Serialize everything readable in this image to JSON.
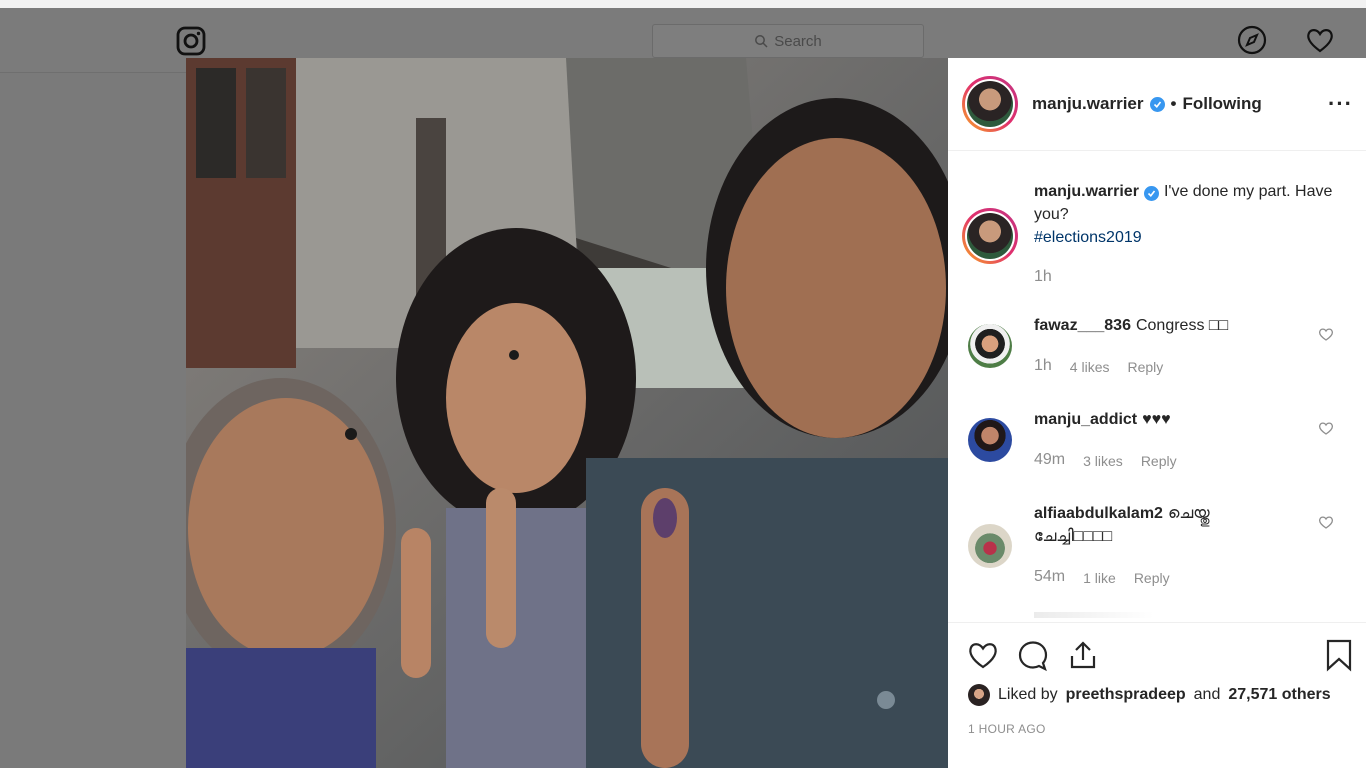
{
  "nav": {
    "search_placeholder": "Search",
    "logo_icon": "instagram-icon",
    "explore_icon": "compass-icon",
    "activity_icon": "heart-icon"
  },
  "post": {
    "author": "manju.warrier",
    "follow_state": "Following",
    "more_icon": "more-icon",
    "more_label": "···"
  },
  "caption": {
    "username": "manju.warrier",
    "text": "I've done my part. Have you?",
    "hashtag": "#elections2019",
    "time": "1h"
  },
  "comments": [
    {
      "username": "fawaz___836",
      "text": "Congress □□",
      "time": "1h",
      "likes": "4 likes",
      "reply": "Reply"
    },
    {
      "username": "manju_addict",
      "text": "♥♥♥",
      "time": "49m",
      "likes": "3 likes",
      "reply": "Reply"
    },
    {
      "username": "alfiaabdulkalam2",
      "text": "ചെയ്തു ചേച്ചി□□□□",
      "time": "54m",
      "likes": "1 like",
      "reply": "Reply"
    }
  ],
  "actions": {
    "like_icon": "heart-icon",
    "comment_icon": "comment-icon",
    "share_icon": "share-icon",
    "save_icon": "bookmark-icon"
  },
  "likes": {
    "prefix": "Liked by",
    "user": "preethspradeep",
    "joiner": "and",
    "others": "27,571 others"
  },
  "timestamp": "1 HOUR AGO",
  "colors": {
    "overlay": "#7a7a7a",
    "verified": "#3897f0",
    "hashtag": "#003569",
    "muted": "#8e8e8e"
  }
}
